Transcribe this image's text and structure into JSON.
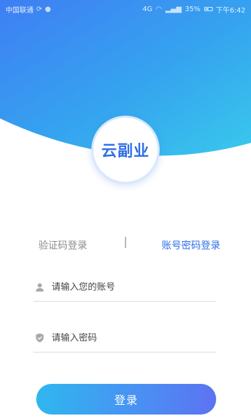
{
  "status_bar": {
    "carrier": "中国联通",
    "network": "4G",
    "battery": "35%",
    "time": "下午6:42"
  },
  "app": {
    "logo_text": "云副业"
  },
  "tabs": {
    "sms_login": "验证码登录",
    "password_login": "账号密码登录",
    "active": "password_login"
  },
  "form": {
    "account_placeholder": "请输入您的账号",
    "password_placeholder": "请输入密码"
  },
  "login_button": "登录",
  "colors": {
    "accent": "#2d6ee8",
    "header_gradient_start": "#36b4f0",
    "header_gradient_end": "#5c6ff2"
  }
}
